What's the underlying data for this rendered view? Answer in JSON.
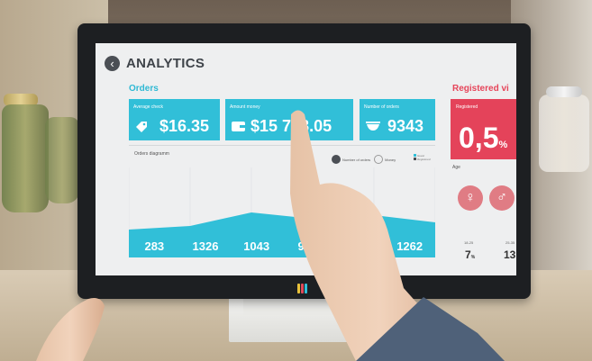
{
  "screen": {
    "title": "ANALYTICS",
    "back_icon": "arrow-left-icon",
    "orders": {
      "title": "Orders",
      "cards": [
        {
          "label": "Average check",
          "value": "$16.35",
          "icon": "price-tag-icon"
        },
        {
          "label": "Amount money",
          "value": "$15 758.05",
          "icon": "wallet-icon"
        },
        {
          "label": "Number of orders",
          "value": "9343",
          "icon": "bowl-icon"
        }
      ],
      "diagram": {
        "label": "Orders diagramm",
        "legend": [
          "Number of orders",
          "Money"
        ],
        "legend_keys": [
          "Guest",
          "Registered"
        ],
        "values": [
          "283",
          "1326",
          "1043",
          "980",
          "",
          "1262"
        ],
        "level": [
          0.31,
          0.35,
          0.5,
          0.43,
          0.47,
          0.39
        ]
      }
    },
    "registered": {
      "title": "Registered vi",
      "card_label": "Registered",
      "card_value": "0,5",
      "card_unit": "%",
      "age_label": "Age",
      "stats": [
        {
          "label": "18-25",
          "value": "7",
          "unit": "%"
        },
        {
          "label": "25-35",
          "value": "13",
          "unit": ""
        }
      ]
    }
  },
  "colors": {
    "cyan": "#31bfd8",
    "red": "#e4435a",
    "screen_bg": "#eeeff0",
    "bezel": "#1d1f22"
  }
}
